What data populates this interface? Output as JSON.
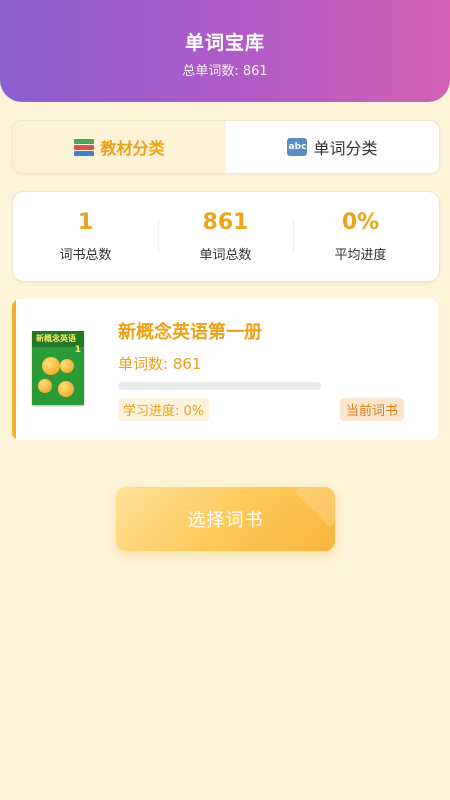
{
  "header": {
    "title": "单词宝库",
    "subtitle": "总单词数: 861"
  },
  "tabs": [
    {
      "label": "教材分类",
      "icon": "books-icon",
      "active": true
    },
    {
      "label": "单词分类",
      "icon": "abc-icon",
      "active": false
    }
  ],
  "stats": [
    {
      "value": "1",
      "label": "词书总数"
    },
    {
      "value": "861",
      "label": "单词总数"
    },
    {
      "value": "0%",
      "label": "平均进度"
    }
  ],
  "book": {
    "title": "新概念英语第一册",
    "word_count": "单词数: 861",
    "progress_text": "学习进度: 0%",
    "progress_fraction": 0,
    "badge": "当前词书",
    "cover": {
      "title": "新概念英语",
      "volume": "1"
    }
  },
  "actions": {
    "select_label": "选择词书"
  },
  "colors": {
    "accent": "#e9a21a",
    "header_start": "#8a5fd0",
    "header_end": "#d35fb3",
    "background": "#fdf4d9"
  }
}
